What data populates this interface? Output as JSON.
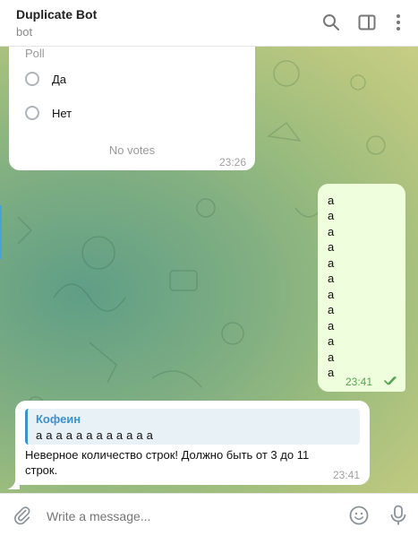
{
  "header": {
    "title": "Duplicate Bot",
    "subtitle": "bot",
    "icons": [
      "search-icon",
      "sidebar-toggle-icon",
      "more-vertical-icon"
    ]
  },
  "poll": {
    "label": "Poll",
    "options": [
      "Да",
      "Нет"
    ],
    "votes": "No votes",
    "time": "23:26"
  },
  "outgoing": {
    "lines": [
      "а",
      "а",
      "а",
      "а",
      "а",
      "а",
      "а",
      "а",
      "а",
      "а",
      "а",
      "а"
    ],
    "time": "23:41",
    "status_icon": "double-check-icon"
  },
  "incoming": {
    "reply_name": "Кофеин",
    "reply_text": "а а а а а а а а а а а а",
    "text": "Неверное количество строк! Должно быть от 3 до 11 строк.",
    "time": "23:41"
  },
  "composer": {
    "placeholder": "Write a message...",
    "icons": [
      "paperclip-icon",
      "emoji-icon",
      "microphone-icon"
    ]
  },
  "colors": {
    "accent": "#3d91c9",
    "outgoing_bubble": "#effedd",
    "check_green": "#57a454"
  }
}
